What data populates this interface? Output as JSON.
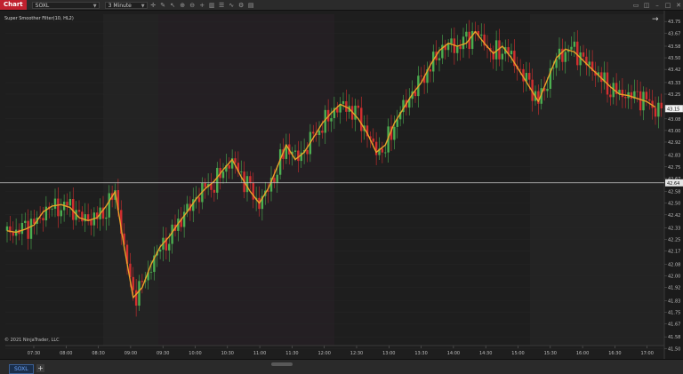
{
  "toolbar": {
    "chart_tab": "Chart",
    "instrument": "SOXL",
    "interval": "3 Minute",
    "icons": [
      "crosshair-icon",
      "pencil-icon",
      "cursor-icon",
      "zoom-in-icon",
      "zoom-out-icon",
      "plus-icon",
      "chart-style-icon",
      "properties-icon",
      "indicators-icon",
      "strategy-icon",
      "template-icon",
      "window-icon",
      "camera-icon"
    ]
  },
  "chart": {
    "indicator_label": "Super Smoother Filter(10, HL2)",
    "copyright": "© 2021 NinjaTrader, LLC",
    "current_price": "43.15",
    "crosshair_price": "42.64",
    "colors": {
      "up": "#4caf50",
      "down": "#d32f2f",
      "filter": "#e8a12a",
      "crosshair": "#c8c8c8"
    }
  },
  "chart_data": {
    "type": "line",
    "x_labels": [
      "07:30",
      "08:00",
      "08:30",
      "09:00",
      "09:30",
      "10:00",
      "10:30",
      "11:00",
      "11:30",
      "12:00",
      "12:30",
      "13:00",
      "13:30",
      "14:00",
      "14:30",
      "15:00",
      "15:30",
      "16:00",
      "16:30",
      "17:00"
    ],
    "y_labels": [
      "43.75",
      "43.67",
      "43.58",
      "43.50",
      "43.42",
      "43.33",
      "43.25",
      "43.16",
      "43.08",
      "43.00",
      "42.92",
      "42.83",
      "42.75",
      "42.67",
      "42.58",
      "42.50",
      "42.42",
      "42.33",
      "42.25",
      "42.17",
      "42.08",
      "42.00",
      "41.92",
      "41.83",
      "41.75",
      "41.67",
      "41.58",
      "41.50"
    ],
    "ylim": [
      41.52,
      43.8
    ],
    "series": [
      {
        "name": "Super Smoother Filter(10, HL2)",
        "values": [
          42.31,
          42.3,
          42.32,
          42.35,
          42.44,
          42.48,
          42.49,
          42.47,
          42.4,
          42.38,
          42.4,
          42.48,
          42.58,
          42.2,
          41.85,
          41.92,
          42.08,
          42.2,
          42.27,
          42.36,
          42.44,
          42.53,
          42.6,
          42.65,
          42.73,
          42.8,
          42.68,
          42.58,
          42.5,
          42.6,
          42.75,
          42.9,
          42.8,
          42.85,
          42.95,
          43.05,
          43.12,
          43.18,
          43.15,
          43.08,
          42.98,
          42.85,
          42.9,
          43.05,
          43.15,
          43.25,
          43.33,
          43.45,
          43.55,
          43.6,
          43.58,
          43.6,
          43.68,
          43.6,
          43.53,
          43.58,
          43.5,
          43.4,
          43.3,
          43.2,
          43.35,
          43.5,
          43.56,
          43.54,
          43.48,
          43.42,
          43.36,
          43.3,
          43.25,
          43.24,
          43.22,
          43.2,
          43.16
        ]
      }
    ]
  },
  "footer": {
    "tab_label": "SOXL",
    "add_label": "+"
  }
}
